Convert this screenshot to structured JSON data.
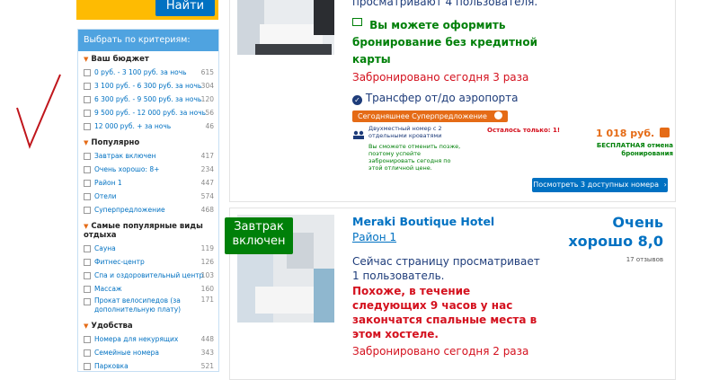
{
  "search": {
    "button_label": "Найти"
  },
  "filter": {
    "header": "Выбрать по критериям:",
    "groups": [
      {
        "title": "Ваш бюджет",
        "items": [
          {
            "label": "0 руб. - 3 100 руб. за ночь",
            "count": "615"
          },
          {
            "label": "3 100 руб. - 6 300 руб. за ночь",
            "count": "304"
          },
          {
            "label": "6 300 руб. - 9 500 руб. за ночь",
            "count": "120"
          },
          {
            "label": "9 500 руб. - 12 000 руб. за ночь",
            "count": "56"
          },
          {
            "label": "12 000 руб. + за ночь",
            "count": "46"
          }
        ]
      },
      {
        "title": "Популярно",
        "items": [
          {
            "label": "Завтрак включен",
            "count": "417"
          },
          {
            "label": "Очень хорошо: 8+",
            "count": "234"
          },
          {
            "label": "Район 1",
            "count": "447"
          },
          {
            "label": "Отели",
            "count": "574"
          },
          {
            "label": "Суперпредложение",
            "count": "468"
          }
        ]
      },
      {
        "title": "Самые популярные виды отдыха",
        "items": [
          {
            "label": "Сауна",
            "count": "119"
          },
          {
            "label": "Фитнес-центр",
            "count": "126"
          },
          {
            "label": "Спа и оздоровительный центр",
            "count": "103"
          },
          {
            "label": "Массаж",
            "count": "160"
          },
          {
            "label": "Прокат велосипедов (за дополнительную плату)",
            "count": "171"
          }
        ]
      },
      {
        "title": "Удобства",
        "items": [
          {
            "label": "Номера для некурящих",
            "count": "448"
          },
          {
            "label": "Семейные номера",
            "count": "343"
          },
          {
            "label": "Парковка",
            "count": "521"
          }
        ]
      }
    ]
  },
  "listing1": {
    "viewing_text": "просматривают 4 пользователя.",
    "no_card_text": "Вы можете оформить бронирование без кредитной карты",
    "booked_today": "Забронировано сегодня 3 раза",
    "transfer": "Трансфер от/до аэропорта",
    "deal_badge": "Сегодняшнее Суперпредложение",
    "room_type": "Двухместный номер с 2 отдельными кроватями",
    "cancel_note": "Вы сможете отменить позже, поэтому успейте забронировать сегодня по этой отличной цене.",
    "only_left": "Осталось только: 1!",
    "price": "1 018 руб.",
    "free_cancel": "БЕСПЛАТНАЯ отмена бронирования",
    "cta": "Посмотреть 3 доступных номера"
  },
  "listing2": {
    "badge": "Завтрак включен",
    "name": "Meraki Boutique Hotel",
    "district": "Район 1",
    "score_label": "Очень хорошо 8,0",
    "reviews": "17 отзывов",
    "viewing_text": "Сейчас страницу просматривает 1 пользователь.",
    "urgency": "Похоже, в течение следующих 9 часов у нас закончатся спальные места в этом хостеле.",
    "booked_today": "Забронировано сегодня 2 раза"
  },
  "colors": {
    "accent_blue": "#0071c2",
    "brand_yellow": "#febb02",
    "green": "#008009",
    "red": "#d4111e",
    "orange": "#e56b16"
  }
}
